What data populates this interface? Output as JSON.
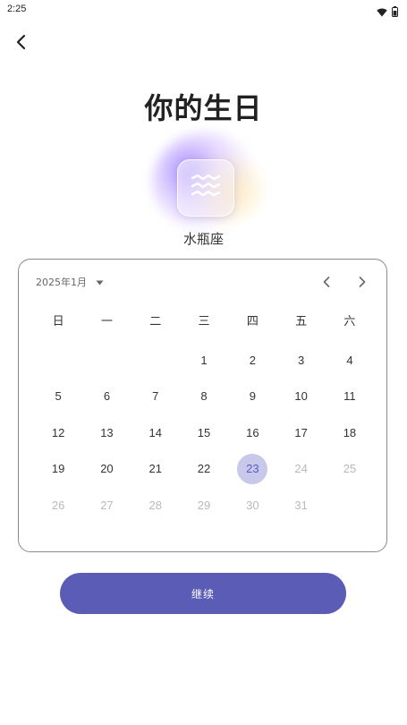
{
  "status_bar": {
    "time": "2:25"
  },
  "header": {
    "title": "你的生日"
  },
  "zodiac": {
    "name": "水瓶座",
    "icon": "aquarius-icon"
  },
  "calendar": {
    "month_label": "2025年1月",
    "weekdays": [
      "日",
      "一",
      "二",
      "三",
      "四",
      "五",
      "六"
    ],
    "days": [
      {
        "label": "",
        "state": "empty"
      },
      {
        "label": "",
        "state": "empty"
      },
      {
        "label": "",
        "state": "empty"
      },
      {
        "label": "1",
        "state": "normal"
      },
      {
        "label": "2",
        "state": "normal"
      },
      {
        "label": "3",
        "state": "normal"
      },
      {
        "label": "4",
        "state": "normal"
      },
      {
        "label": "5",
        "state": "normal"
      },
      {
        "label": "6",
        "state": "normal"
      },
      {
        "label": "7",
        "state": "normal"
      },
      {
        "label": "8",
        "state": "normal"
      },
      {
        "label": "9",
        "state": "normal"
      },
      {
        "label": "10",
        "state": "normal"
      },
      {
        "label": "11",
        "state": "normal"
      },
      {
        "label": "12",
        "state": "normal"
      },
      {
        "label": "13",
        "state": "normal"
      },
      {
        "label": "14",
        "state": "normal"
      },
      {
        "label": "15",
        "state": "normal"
      },
      {
        "label": "16",
        "state": "normal"
      },
      {
        "label": "17",
        "state": "normal"
      },
      {
        "label": "18",
        "state": "normal"
      },
      {
        "label": "19",
        "state": "normal"
      },
      {
        "label": "20",
        "state": "normal"
      },
      {
        "label": "21",
        "state": "normal"
      },
      {
        "label": "22",
        "state": "normal"
      },
      {
        "label": "23",
        "state": "selected"
      },
      {
        "label": "24",
        "state": "disabled"
      },
      {
        "label": "25",
        "state": "disabled"
      },
      {
        "label": "26",
        "state": "disabled"
      },
      {
        "label": "27",
        "state": "disabled"
      },
      {
        "label": "28",
        "state": "disabled"
      },
      {
        "label": "29",
        "state": "disabled"
      },
      {
        "label": "30",
        "state": "disabled"
      },
      {
        "label": "31",
        "state": "disabled"
      }
    ]
  },
  "actions": {
    "continue_label": "继续"
  },
  "colors": {
    "accent": "#5b5cb6",
    "selected_bg": "#c7c8ea",
    "disabled_text": "#b9b9b9"
  }
}
